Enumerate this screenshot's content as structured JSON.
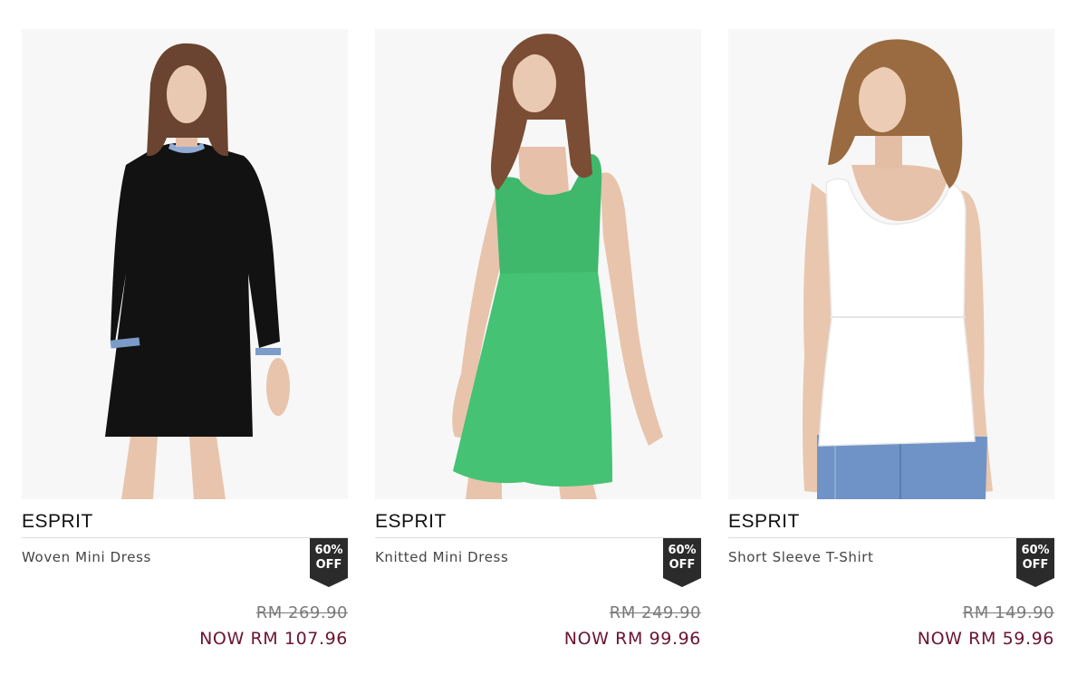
{
  "colors": {
    "badge_bg": "#2b2b2b",
    "now_price": "#6b1530",
    "old_price": "#7a7a7a",
    "divider": "#dcdcdc"
  },
  "products": [
    {
      "brand": "ESPRIT",
      "name": "Woven Mini Dress",
      "badge_line1": "60%",
      "badge_line2": "OFF",
      "old_price": "RM 269.90",
      "new_price": "NOW RM 107.96",
      "image_icon": "black-dress-photo"
    },
    {
      "brand": "ESPRIT",
      "name": "Knitted Mini Dress",
      "badge_line1": "60%",
      "badge_line2": "OFF",
      "old_price": "RM 249.90",
      "new_price": "NOW RM 99.96",
      "image_icon": "green-dress-photo"
    },
    {
      "brand": "ESPRIT",
      "name": "Short Sleeve T-Shirt",
      "badge_line1": "60%",
      "badge_line2": "OFF",
      "old_price": "RM 149.90",
      "new_price": "NOW RM 59.96",
      "image_icon": "white-top-photo"
    }
  ]
}
